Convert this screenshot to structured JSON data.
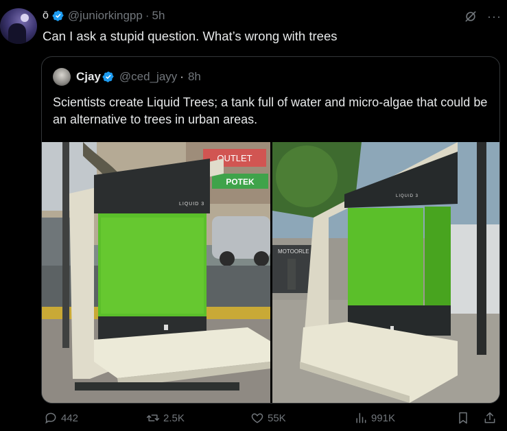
{
  "post": {
    "author_symbol": "ō",
    "handle": "@juniorkingpp",
    "time": "5h",
    "text": "Can I ask a stupid question. What’s wrong with trees",
    "more_label": "···"
  },
  "quote": {
    "name": "Cjay",
    "handle": "@ced_jayy",
    "time": "8h",
    "text": "Scientists create Liquid Trees; a tank full of water and micro-algae that could be an alternative to trees in urban areas.",
    "photos": [
      {
        "panel_label": "LIQUID 3",
        "sign_text_1": "OUTLET",
        "sign_text_2": "POTEK"
      },
      {
        "panel_label": "LIQUID 3",
        "sign_text_1": "MOTOORLE"
      }
    ]
  },
  "actions": {
    "replies": "442",
    "reposts": "2.5K",
    "likes": "55K",
    "views": "991K"
  },
  "colors": {
    "background": "#000000",
    "text": "#e7e9ea",
    "muted": "#71767b",
    "verified": "#1d9bf0",
    "border": "#333639",
    "algae": "#5bbf2a"
  },
  "icons": {
    "verified": "verified-badge-icon",
    "grok": "grok-icon",
    "reply": "reply-icon",
    "repost": "repost-icon",
    "like": "heart-icon",
    "views": "views-icon",
    "bookmark": "bookmark-icon",
    "share": "share-icon"
  }
}
